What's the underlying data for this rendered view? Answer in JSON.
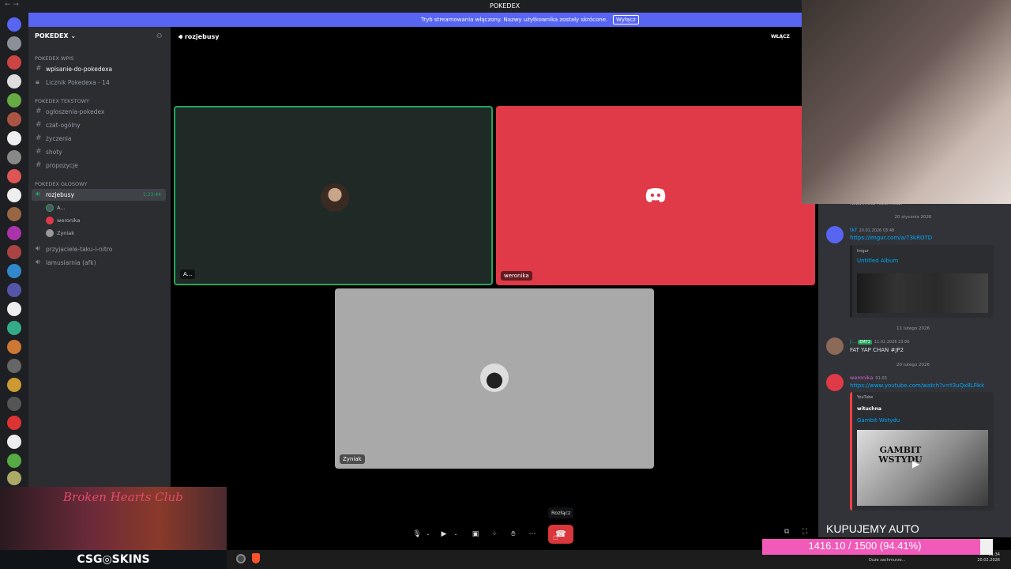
{
  "window": {
    "title": "POKEDEX"
  },
  "banner": {
    "text": "Tryb streamowania włączony. Nazwy użytkownika zostały skrócone.",
    "button": "Wyłącz"
  },
  "server": {
    "name": "POKEDEX ⌄"
  },
  "sidebar": {
    "categories": [
      "POKEDEX Wpis",
      "POKEDEX Tekstowy",
      "POKEDEX GŁOSOWY"
    ],
    "channels": [
      {
        "label": "wpisanie-do-pokedexa"
      },
      {
        "label": "Licznik Pokedexa - 14"
      },
      {
        "label": "ogłoszenia-pokedex"
      },
      {
        "label": "czat-ogólny"
      },
      {
        "label": "życzenia"
      },
      {
        "label": "shoty"
      },
      {
        "label": "propozycje"
      },
      {
        "label": "rozjebusy",
        "timer": "1:23:44"
      },
      {
        "label": "przyjaciele-taku-i-nitro"
      },
      {
        "label": "lamusiarnia (afk)"
      }
    ],
    "voice_users": [
      "A...",
      "weronika",
      "Zyniak"
    ]
  },
  "main": {
    "channel_name": "rozjebusy",
    "enable_label": "WŁĄCZ"
  },
  "tiles": [
    {
      "name": "A..."
    },
    {
      "name": "weronika"
    },
    {
      "name": "Zyniak"
    }
  ],
  "controls": {
    "tooltip": "Rozłącz",
    "hangup_icon": "phone-hangup-icon"
  },
  "chat": {
    "top_text": "Rozumiesz rozumiesz?",
    "dates": [
      "20 stycznia 2026",
      "11 lutego 2026",
      "20 lutego 2026"
    ],
    "messages": [
      {
        "author": "tkf",
        "time": "20.01.2026 03:48",
        "link": "https://imgur.com/a/73kROTD",
        "embed_provider": "Imgur",
        "embed_title": "Untitled Album"
      },
      {
        "author": "J...",
        "tag": "EMT2",
        "time": "11.02.2026 23:06",
        "text": "FAT YAP CHAN #JP2"
      },
      {
        "author": "weronika",
        "time": "01:03",
        "link": "https://www.youtube.com/watch?v=t3uQx8LFikk",
        "embed_provider": "YouTube",
        "embed_author": "wituchna",
        "embed_title": "Gambit Wstydu",
        "thumb_text": "GAMBIT WSTYDU"
      }
    ]
  },
  "overlay": {
    "ad_title": "Broken Hearts Club",
    "csg_text": "CSG◎SKINS",
    "kupujemy": "KUPUJEMY AUTO",
    "progress_text": "1416.10 / 1500 (94.41%)",
    "progress_fraction": 0.9441,
    "progress_color": "#f25ab9"
  },
  "taskbar": {
    "time": "01:34",
    "date": "20.02.2026",
    "weather": "Duże zachmurze..."
  },
  "colors": {
    "accent": "#5865f2",
    "red": "#da373c",
    "tile_red": "#e03a49",
    "tile_dark": "#1f2a27",
    "tile_grey": "#a9a9a9",
    "speaking": "#23a55a"
  }
}
